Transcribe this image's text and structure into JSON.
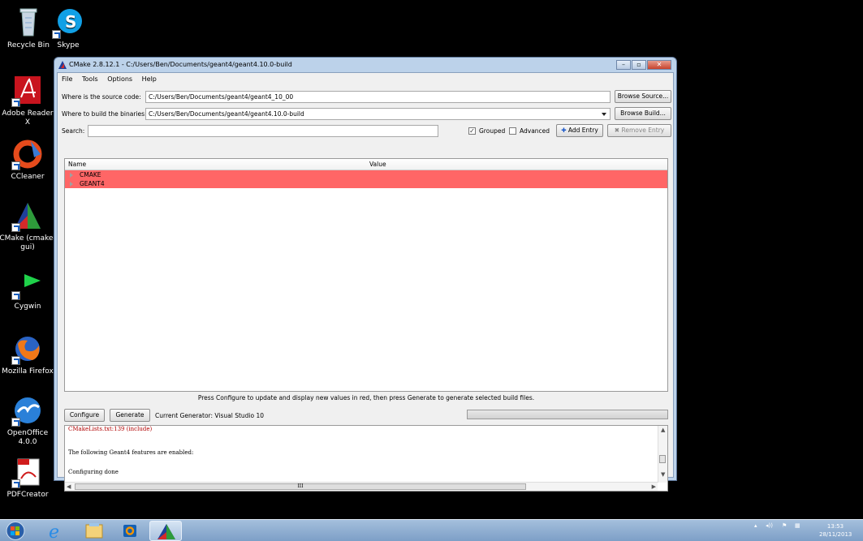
{
  "desktop": {
    "icons": [
      {
        "label": "Recycle Bin"
      },
      {
        "label": "Skype"
      },
      {
        "label": "Adobe Reader X"
      },
      {
        "label": "CCleaner"
      },
      {
        "label": "CMake (cmake-gui)"
      },
      {
        "label": "Cygwin"
      },
      {
        "label": "Mozilla Firefox"
      },
      {
        "label": "OpenOffice 4.0.0"
      },
      {
        "label": "PDFCreator"
      }
    ]
  },
  "window": {
    "title": "CMake 2.8.12.1 - C:/Users/Ben/Documents/geant4/geant4.10.0-build",
    "minimize_icon": "minimize-icon",
    "maximize_icon": "maximize-icon",
    "close_icon": "close-icon"
  },
  "menu": [
    "File",
    "Tools",
    "Options",
    "Help"
  ],
  "source": {
    "label": "Where is the source code:",
    "value": "C:/Users/Ben/Documents/geant4/geant4_10_00",
    "browse": "Browse Source..."
  },
  "build": {
    "label": "Where to build the binaries:",
    "value": "C:/Users/Ben/Documents/geant4/geant4.10.0-build",
    "browse": "Browse Build..."
  },
  "search": {
    "label": "Search:",
    "value": ""
  },
  "options": {
    "grouped": "Grouped",
    "grouped_checked": true,
    "advanced": "Advanced",
    "advanced_checked": false,
    "add_entry": "Add Entry",
    "remove_entry": "Remove Entry"
  },
  "tree": {
    "columns": [
      "Name",
      "Value"
    ],
    "rows": [
      "CMAKE",
      "GEANT4"
    ],
    "row_color": "#ff6666"
  },
  "hint": "Press Configure to update and display new values in red, then press Generate to generate selected build files.",
  "actions": {
    "configure": "Configure",
    "generate": "Generate",
    "generator": "Current Generator: Visual Studio 10"
  },
  "output": {
    "lines": [
      "CMakeLists.txt:139 (include)",
      "The following Geant4 features are enabled:",
      "Configuring done"
    ],
    "hscroll_grip": "III"
  },
  "taskbar": {
    "time": "13:53",
    "date": "28/11/2013"
  }
}
